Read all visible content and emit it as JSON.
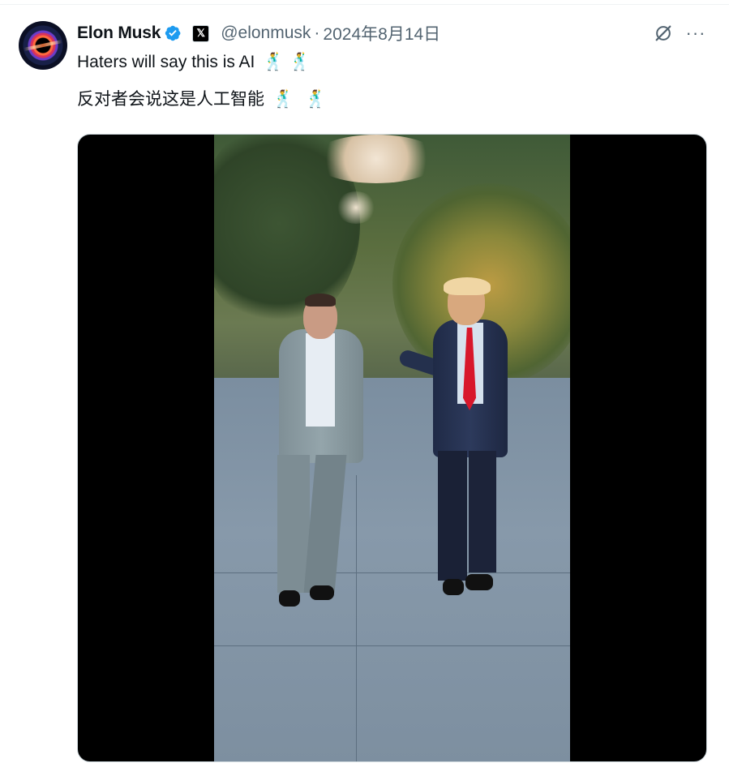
{
  "tweet": {
    "author_name": "Elon Musk",
    "handle": "@elonmusk",
    "separator": "·",
    "date": "2024年8月14日",
    "affiliate_badge": "𝕏",
    "text_en": "Haters will say this is AI",
    "text_zh": "反对者会说这是人工智能",
    "emoji": "🕺",
    "more_label": "···",
    "icons": [
      "verified-badge-icon",
      "x-affiliate-icon",
      "grok-icon",
      "more-icon"
    ],
    "media_type": "video"
  },
  "colors": {
    "text_primary": "#0f1419",
    "text_secondary": "#536471",
    "verified_blue": "#1d9bf0",
    "border": "#cfd9de",
    "media_bg": "#000000"
  }
}
